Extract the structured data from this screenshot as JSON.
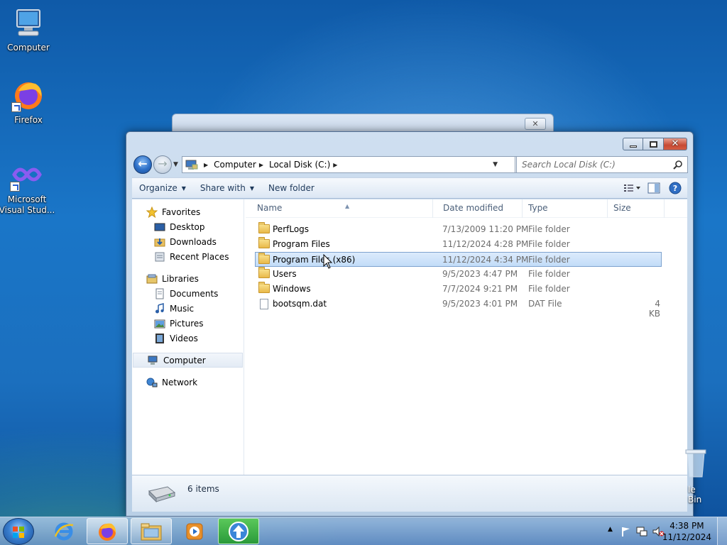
{
  "desktop": {
    "icons": [
      {
        "label": "Computer"
      },
      {
        "label": "Firefox"
      },
      {
        "label": "Microsoft Visual Stud..."
      }
    ],
    "recycle_label": "le Bin"
  },
  "background_dialog": {
    "close_glyph": "✕"
  },
  "window": {
    "address": {
      "crumbs": [
        "Computer",
        "Local Disk (C:)"
      ]
    },
    "search": {
      "placeholder": "Search Local Disk (C:)"
    },
    "toolbar": {
      "organize": "Organize",
      "share_with": "Share with",
      "new_folder": "New folder"
    },
    "nav": {
      "favorites": "Favorites",
      "desktop": "Desktop",
      "downloads": "Downloads",
      "recent_places": "Recent Places",
      "libraries": "Libraries",
      "documents": "Documents",
      "music": "Music",
      "pictures": "Pictures",
      "videos": "Videos",
      "computer": "Computer",
      "network": "Network"
    },
    "columns": {
      "name": "Name",
      "date_modified": "Date modified",
      "type": "Type",
      "size": "Size"
    },
    "files": [
      {
        "name": "PerfLogs",
        "date": "7/13/2009 11:20 PM",
        "type": "File folder",
        "size": "",
        "icon": "folder-icon"
      },
      {
        "name": "Program Files",
        "date": "11/12/2024 4:28 PM",
        "type": "File folder",
        "size": "",
        "icon": "folder-icon"
      },
      {
        "name": "Program Files (x86)",
        "date": "11/12/2024 4:34 PM",
        "type": "File folder",
        "size": "",
        "icon": "folder-icon",
        "selected": true
      },
      {
        "name": "Users",
        "date": "9/5/2023 4:47 PM",
        "type": "File folder",
        "size": "",
        "icon": "folder-icon"
      },
      {
        "name": "Windows",
        "date": "7/7/2024 9:21 PM",
        "type": "File folder",
        "size": "",
        "icon": "folder-icon"
      },
      {
        "name": "bootsqm.dat",
        "date": "9/5/2023 4:01 PM",
        "type": "DAT File",
        "size": "4 KB",
        "icon": "file-icon"
      }
    ],
    "status": {
      "count": "6 items"
    }
  },
  "taskbar": {
    "time": "4:38 PM",
    "date": "11/12/2024"
  },
  "colors": {
    "selection": "#c2dcf8",
    "accent": "#2a5fa8"
  }
}
